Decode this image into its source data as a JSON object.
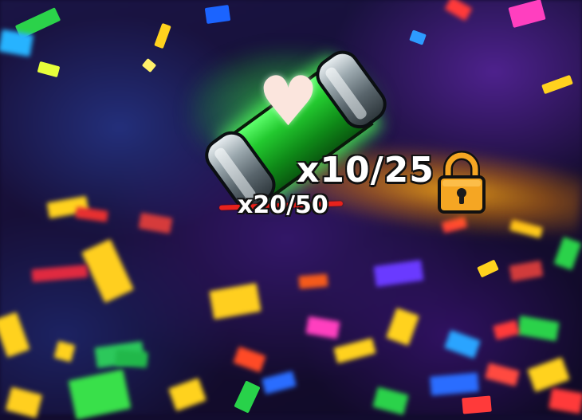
{
  "offer": {
    "new_quantity": "x10/25",
    "old_quantity": "x20/50"
  },
  "icons": {
    "item": "heart-capsule-icon",
    "lock": "lock-icon"
  },
  "colors": {
    "capsule_glow": "#3cff50",
    "lock": "#f5a623",
    "strike": "#e8221c"
  }
}
